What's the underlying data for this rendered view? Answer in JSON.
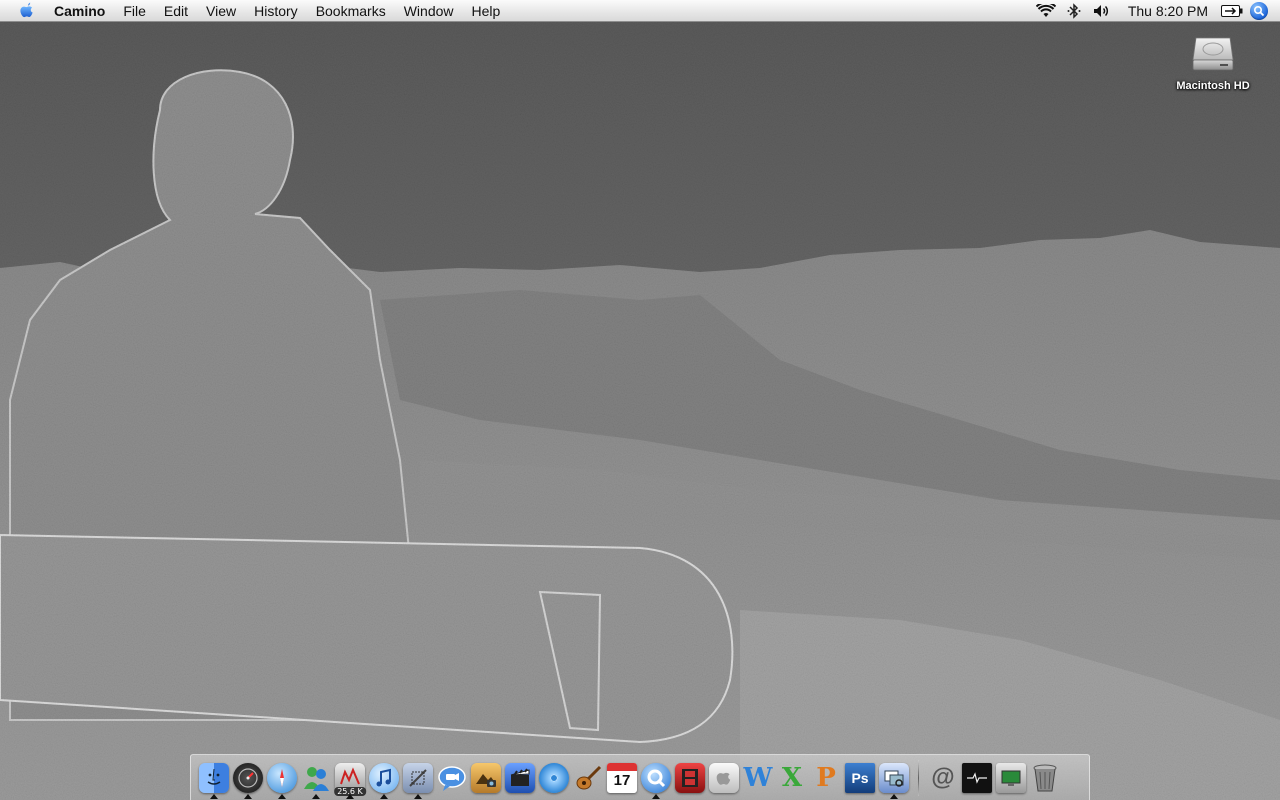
{
  "menubar": {
    "apple_icon": "apple-logo-icon",
    "app_name": "Camino",
    "items": [
      "File",
      "Edit",
      "View",
      "History",
      "Bookmarks",
      "Window",
      "Help"
    ],
    "status_icons": [
      "wifi-icon",
      "bluetooth-icon",
      "volume-icon"
    ],
    "clock": "Thu 8:20 PM",
    "battery_icon": "battery-icon",
    "spotlight_icon": "spotlight-search-icon"
  },
  "desktop": {
    "icons": [
      {
        "label": "Macintosh HD",
        "icon": "hard-drive-icon"
      }
    ],
    "wallpaper": "embossed-snowboarder-mountain-landscape"
  },
  "dock": {
    "apps": [
      {
        "name": "Finder",
        "icon": "finder-icon",
        "color": "#3d7fe0",
        "running": true
      },
      {
        "name": "Dashboard",
        "icon": "dashboard-icon",
        "color": "#2a2a2a",
        "running": true
      },
      {
        "name": "Safari",
        "icon": "safari-compass-icon",
        "color": "#4da2e8",
        "running": true
      },
      {
        "name": "MSN Messenger",
        "icon": "messenger-people-icon",
        "color": "#3fa84b",
        "running": true
      },
      {
        "name": "Activity Monitor",
        "icon": "activity-monitor-icon",
        "color": "#c44",
        "running": true,
        "badge": "25.6 K"
      },
      {
        "name": "iTunes",
        "icon": "itunes-note-icon",
        "color": "#5fa8ee",
        "running": true
      },
      {
        "name": "Mail",
        "icon": "mail-stamp-icon",
        "color": "#7b8fb0",
        "running": true
      },
      {
        "name": "iChat",
        "icon": "ichat-bubble-icon",
        "color": "#4a90e2",
        "running": false
      },
      {
        "name": "iPhoto",
        "icon": "iphoto-icon",
        "color": "#b57a2a",
        "running": false
      },
      {
        "name": "iMovie",
        "icon": "imovie-clapper-icon",
        "color": "#3c6fd1",
        "running": false
      },
      {
        "name": "iDVD",
        "icon": "idvd-disc-icon",
        "color": "#5ab0f0",
        "running": false
      },
      {
        "name": "GarageBand",
        "icon": "garageband-guitar-icon",
        "color": "#c57a2b",
        "running": false
      },
      {
        "name": "iCal",
        "icon": "ical-calendar-icon",
        "color": "#ffffff",
        "running": false,
        "date": "17"
      },
      {
        "name": "QuickTime",
        "icon": "quicktime-q-icon",
        "color": "#3a8ae5",
        "running": true
      },
      {
        "name": "DVD Player",
        "icon": "film-strip-icon",
        "color": "#b22",
        "running": false
      },
      {
        "name": "System Profiler",
        "icon": "apple-gray-icon",
        "color": "#dcdcdc",
        "running": false
      },
      {
        "name": "Word",
        "icon": "word-w-icon",
        "color": "#2f82d8",
        "running": false
      },
      {
        "name": "Excel",
        "icon": "excel-x-icon",
        "color": "#3aa83a",
        "running": false
      },
      {
        "name": "PowerPoint",
        "icon": "powerpoint-p-icon",
        "color": "#e07a1f",
        "running": false
      },
      {
        "name": "Photoshop",
        "icon": "photoshop-ps-icon",
        "color": "#1f5fa8",
        "running": false,
        "text": "Ps"
      },
      {
        "name": "Preview",
        "icon": "preview-photos-icon",
        "color": "#6a8ccc",
        "running": true
      }
    ],
    "docs": [
      {
        "name": "Internet Connect",
        "icon": "at-sign-icon"
      },
      {
        "name": "Console",
        "icon": "console-monitor-icon"
      },
      {
        "name": "Desktop",
        "icon": "desktop-folder-icon"
      },
      {
        "name": "Trash",
        "icon": "trash-icon"
      }
    ]
  }
}
